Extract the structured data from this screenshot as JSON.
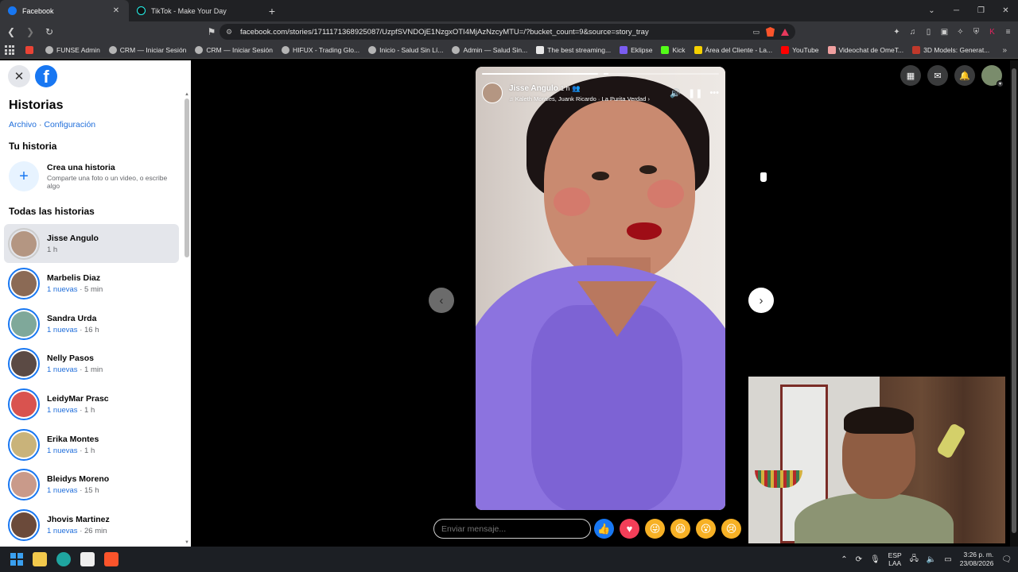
{
  "browser": {
    "tabs": [
      {
        "title": "Facebook",
        "active": true,
        "icon": "facebook-favicon"
      },
      {
        "title": "TikTok - Make Your Day",
        "active": false,
        "icon": "tiktok-favicon"
      }
    ],
    "new_tab": "+",
    "url": "facebook.com/stories/1711171368925087/UzpfSVNDOjE1NzgxOTI4MjAzNzcyMTU=/?bucket_count=9&source=story_tray",
    "bookmarks": [
      {
        "label": "FUNSE Admin",
        "color": "#b5b5b5"
      },
      {
        "label": "CRM — Iniciar Sesión",
        "color": "#b5b5b5"
      },
      {
        "label": "CRM — Iniciar Sesión",
        "color": "#b5b5b5"
      },
      {
        "label": "HIFUX - Trading Glo...",
        "color": "#b5b5b5"
      },
      {
        "label": "Inicio - Salud Sin Lí...",
        "color": "#b5b5b5"
      },
      {
        "label": "Admin — Salud Sin...",
        "color": "#b5b5b5"
      },
      {
        "label": "The best streaming...",
        "color": "#e8e8e8"
      },
      {
        "label": "Eklipse",
        "color": "#7a5cf0"
      },
      {
        "label": "Kick",
        "color": "#53fc18"
      },
      {
        "label": "Área del Cliente - La...",
        "color": "#f5d000"
      },
      {
        "label": "YouTube",
        "color": "#ff0000"
      },
      {
        "label": "Videochat de OmeT...",
        "color": "#f0a0a0"
      },
      {
        "label": "3D Models: Generat...",
        "color": "#c0392b"
      }
    ]
  },
  "sidebar": {
    "title": "Historias",
    "archive": "Archivo",
    "separator": "·",
    "settings": "Configuración",
    "your_story": "Tu historia",
    "create_title": "Crea una historia",
    "create_desc": "Comparte una foto o un video, o escribe algo",
    "all_stories": "Todas las historias",
    "stories": [
      {
        "name": "Jisse Angulo",
        "new": "",
        "time": "1 h",
        "selected": true,
        "color": "#b49682"
      },
      {
        "name": "Marbelis Diaz",
        "new": "1 nuevas",
        "time": "5 min",
        "color": "#8b6a55"
      },
      {
        "name": "Sandra Urda",
        "new": "1 nuevas",
        "time": "16 h",
        "color": "#7fa89a"
      },
      {
        "name": "Nelly Pasos",
        "new": "1 nuevas",
        "time": "1 min",
        "color": "#5b4a44"
      },
      {
        "name": "LeidyMar Prasc",
        "new": "1 nuevas",
        "time": "1 h",
        "color": "#d9534f"
      },
      {
        "name": "Erika Montes",
        "new": "1 nuevas",
        "time": "1 h",
        "color": "#c9b37a"
      },
      {
        "name": "Bleidys Moreno",
        "new": "1 nuevas",
        "time": "15 h",
        "color": "#c99a8a"
      },
      {
        "name": "Jhovis Martinez",
        "new": "1 nuevas",
        "time": "26 min",
        "color": "#6b4a3a"
      }
    ]
  },
  "story": {
    "author": "Jisse Angulo",
    "time": "1 h",
    "music": "Kaleth Morales, Juank Ricardo · La Purita Verdad",
    "progress": 0.49,
    "message_placeholder": "Enviar mensaje...",
    "reactions": [
      {
        "icon": "like-icon",
        "glyph": "👍",
        "color": "#1877f2"
      },
      {
        "icon": "love-icon",
        "glyph": "♥",
        "color": "#f33e58"
      },
      {
        "icon": "haha-tongue-icon",
        "glyph": "😜",
        "color": "#f7b125"
      },
      {
        "icon": "laugh-icon",
        "glyph": "😆",
        "color": "#f7b125"
      },
      {
        "icon": "wow-icon",
        "glyph": "😮",
        "color": "#f7b125"
      },
      {
        "icon": "sad-icon",
        "glyph": "😢",
        "color": "#f7b125"
      }
    ]
  },
  "taskbar": {
    "lang_top": "ESP",
    "lang_bottom": "LAA",
    "time": "3:26 p. m.",
    "date": "23/08/2026"
  }
}
